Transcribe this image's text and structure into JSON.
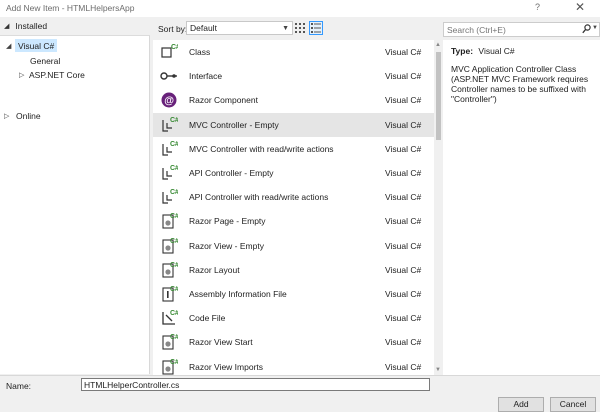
{
  "window": {
    "title": "Add New Item - HTMLHelpersApp",
    "help_glyph": "?",
    "close_glyph": "✕"
  },
  "left_pane": {
    "header": "Installed",
    "tree": [
      {
        "label": "Visual C#",
        "selected": true,
        "expanded": true
      },
      {
        "label": "General"
      },
      {
        "label": "ASP.NET Core",
        "collapsed": true
      }
    ],
    "online": "Online"
  },
  "sortbar": {
    "label": "Sort by:",
    "value": "Default"
  },
  "search": {
    "placeholder": "Search (Ctrl+E)"
  },
  "items": [
    {
      "name": "Class",
      "lang": "Visual C#",
      "icon": "class-icon"
    },
    {
      "name": "Interface",
      "lang": "Visual C#",
      "icon": "interface-icon"
    },
    {
      "name": "Razor Component",
      "lang": "Visual C#",
      "icon": "razor-component-icon"
    },
    {
      "name": "MVC Controller - Empty",
      "lang": "Visual C#",
      "icon": "controller-icon",
      "selected": true
    },
    {
      "name": "MVC Controller with read/write actions",
      "lang": "Visual C#",
      "icon": "controller-icon"
    },
    {
      "name": "API Controller - Empty",
      "lang": "Visual C#",
      "icon": "controller-icon"
    },
    {
      "name": "API Controller with read/write actions",
      "lang": "Visual C#",
      "icon": "controller-icon"
    },
    {
      "name": "Razor Page - Empty",
      "lang": "Visual C#",
      "icon": "razor-page-icon"
    },
    {
      "name": "Razor View - Empty",
      "lang": "Visual C#",
      "icon": "razor-page-icon"
    },
    {
      "name": "Razor Layout",
      "lang": "Visual C#",
      "icon": "razor-page-icon"
    },
    {
      "name": "Assembly Information File",
      "lang": "Visual C#",
      "icon": "assembly-info-icon"
    },
    {
      "name": "Code File",
      "lang": "Visual C#",
      "icon": "code-file-icon"
    },
    {
      "name": "Razor View Start",
      "lang": "Visual C#",
      "icon": "razor-page-icon"
    },
    {
      "name": "Razor View Imports",
      "lang": "Visual C#",
      "icon": "razor-page-icon"
    }
  ],
  "details": {
    "type_key": "Type:",
    "type_value": "Visual C#",
    "description": "MVC Application Controller Class (ASP.NET MVC Framework requires Controller names to be suffixed with \"Controller\")"
  },
  "bottom": {
    "name_label": "Name:",
    "name_value": "HTMLHelperController.cs",
    "add_label": "Add",
    "cancel_label": "Cancel"
  },
  "colors": {
    "selected_tree": "#cce8ff",
    "selected_item": "#e5e5e5",
    "accent": "#3399ff",
    "csharp_green": "#388a34",
    "razor_purple": "#68217a"
  }
}
